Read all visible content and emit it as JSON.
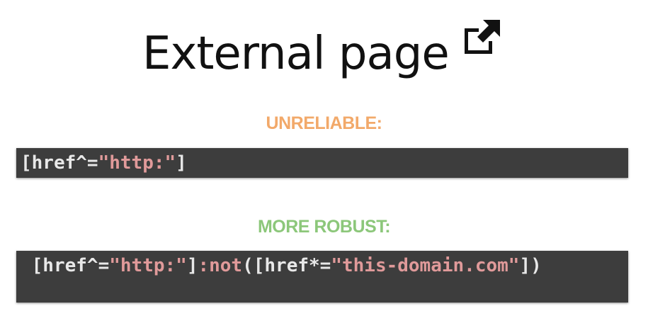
{
  "heading": {
    "title": "External page",
    "icon": "external-link-icon"
  },
  "section_unreliable": {
    "label": "UNRELIABLE:",
    "color": "#f2a96a",
    "code": {
      "open": "[href^=",
      "string": "\"http:\"",
      "close": "]"
    }
  },
  "section_robust": {
    "label": "MORE ROBUST:",
    "color": "#8cc77a",
    "code": {
      "lead": " [href^=",
      "string1": "\"http:\"",
      "mid1": "]",
      "pseudo": ":not",
      "mid2": "([href*=",
      "string2": "\"this-domain.com\"",
      "close": "])"
    }
  },
  "colors": {
    "code_background": "#3d3d3d",
    "code_text": "#e8e8e8",
    "code_string": "#e09a9a"
  }
}
